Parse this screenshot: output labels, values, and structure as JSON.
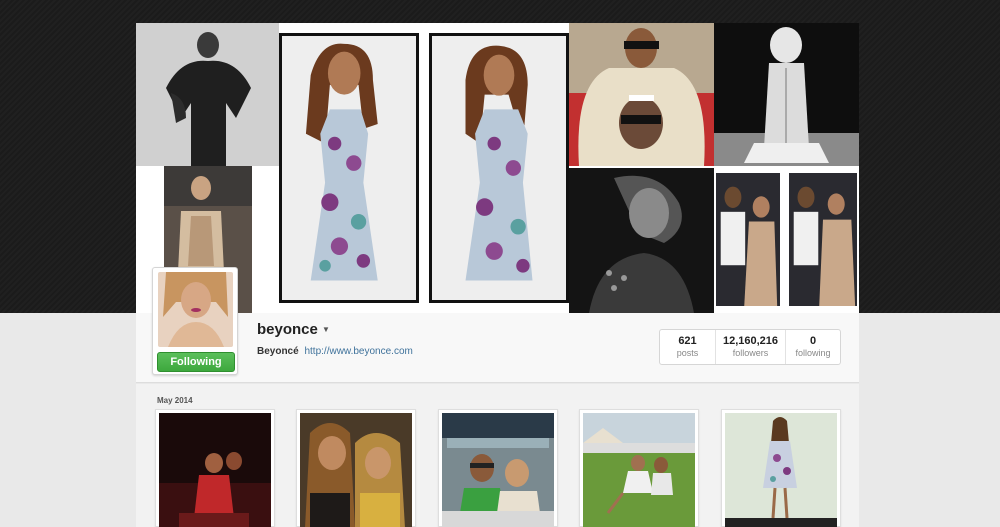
{
  "profile": {
    "username": "beyonce",
    "full_name": "Beyoncé",
    "website": "http://www.beyonce.com",
    "follow_button": "Following",
    "dropdown_icon": "caret-down-icon"
  },
  "stats": [
    {
      "value": "621",
      "label": "posts"
    },
    {
      "value": "12,160,216",
      "label": "followers"
    },
    {
      "value": "0",
      "label": "following"
    }
  ],
  "feed": {
    "month_label": "May 2014"
  },
  "colors": {
    "follow_green": "#3da83d",
    "link_blue": "#3f729b",
    "header_dark": "#1d1d1d"
  }
}
